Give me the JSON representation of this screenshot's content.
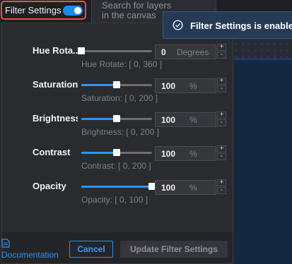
{
  "header": {
    "filter_toggle_label": "Filter Settings",
    "filter_enabled": true
  },
  "search": {
    "placeholder_line1": "Search for layers",
    "placeholder_line2": "in the canvas"
  },
  "toast": {
    "message": "Filter Settings is enabled.",
    "icon": "check-circle-icon"
  },
  "filters": [
    {
      "label": "Hue Rota...",
      "value": "0",
      "unit": "Degrees",
      "range": "Hue Rotate: [ 0, 360 ]",
      "min": 0,
      "max": 360,
      "current": 0
    },
    {
      "label": "Saturation",
      "value": "100",
      "unit": "%",
      "range": "Saturation: [ 0, 200 ]",
      "min": 0,
      "max": 200,
      "current": 100
    },
    {
      "label": "Brightness",
      "value": "100",
      "unit": "%",
      "range": "Brightness: [ 0, 200 ]",
      "min": 0,
      "max": 200,
      "current": 100
    },
    {
      "label": "Contrast",
      "value": "100",
      "unit": "%",
      "range": "Contrast: [ 0, 200 ]",
      "min": 0,
      "max": 200,
      "current": 100
    },
    {
      "label": "Opacity",
      "value": "100",
      "unit": "%",
      "range": "Opacity: [ 0, 100 ]",
      "min": 0,
      "max": 100,
      "current": 100
    }
  ],
  "stepper": {
    "plus": "+",
    "minus": "-"
  },
  "footer": {
    "documentation_label": "Documentation",
    "cancel_label": "Cancel",
    "update_label": "Update Filter Settings"
  },
  "colors": {
    "accent": "#2d95f5",
    "toggle_border": "#e4553c",
    "toast_bg": "#273a55"
  }
}
